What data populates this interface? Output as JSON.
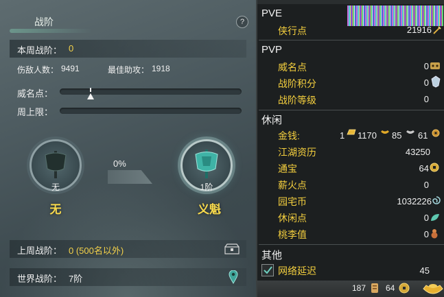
{
  "left": {
    "title": "战阶",
    "help": "?",
    "week_rank_label": "本周战阶：",
    "week_rank_value": "0",
    "kills_label": "伤敌人数：",
    "kills_value": "9491",
    "assist_label": "最佳助攻：",
    "assist_value": "1918",
    "prestige_label": "威名点：",
    "weekly_cap_label": "周上限：",
    "progress_percent": "0%",
    "current_rank_small": "无",
    "current_rank_big": "无",
    "next_rank_small": "1阶",
    "next_rank_big": "义魁",
    "last_week_label": "上周战阶：",
    "last_week_value": "0 (500名以外)",
    "world_rank_label": "世界战阶：",
    "world_rank_value": "7阶"
  },
  "right": {
    "pve": {
      "heading": "PVE",
      "items": [
        {
          "label": "侠行点",
          "value": "21916",
          "icon": "sword-icon"
        }
      ]
    },
    "pvp": {
      "heading": "PVP",
      "items": [
        {
          "label": "威名点",
          "value": "0",
          "icon": "mask-icon"
        },
        {
          "label": "战阶积分",
          "value": "0",
          "icon": "crest-icon"
        },
        {
          "label": "战阶等级",
          "value": "0"
        }
      ]
    },
    "leisure": {
      "heading": "休闲",
      "money_label": "金钱:",
      "money_gold_brick": "1",
      "money_gold": "1170",
      "money_silver": "85",
      "money_copper": "61",
      "items": [
        {
          "label": "江湖资历",
          "value": "43250"
        },
        {
          "label": "通宝",
          "value": "64",
          "icon": "coin-icon"
        },
        {
          "label": "薪火点",
          "value": "0"
        },
        {
          "label": "园宅币",
          "value": "1032226",
          "icon": "swirl-icon"
        },
        {
          "label": "休闲点",
          "value": "0",
          "icon": "leaf-icon"
        },
        {
          "label": "桃李值",
          "value": "0",
          "icon": "gourd-icon"
        }
      ]
    },
    "other": {
      "heading": "其他",
      "latency_label": "网络延迟",
      "latency_value": "45",
      "latency_checked": true
    },
    "bottom": {
      "value_a": "187",
      "value_b": "64"
    }
  },
  "colors": {
    "label_gold": "#f4cf3e",
    "rank_gold": "#f7d94c",
    "panel_dark": "#1c1f20",
    "left_panel": "#4d5b60",
    "teal_accent": "#3fa59a"
  }
}
